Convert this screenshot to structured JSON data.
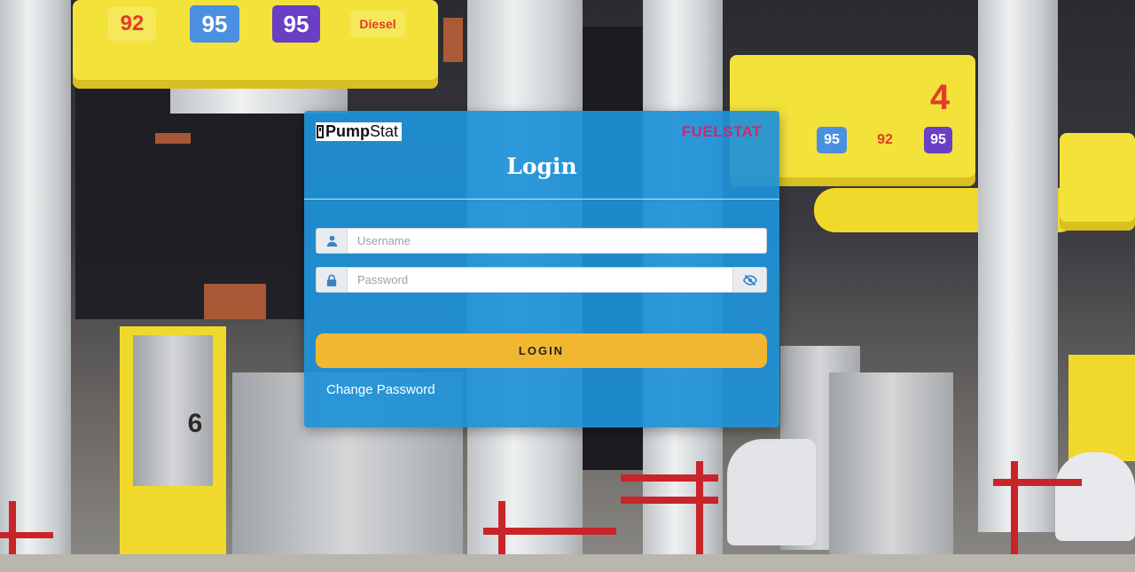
{
  "background": {
    "price_signs_left": [
      "92",
      "95",
      "95",
      "Diesel"
    ],
    "price_signs_right": [
      "95",
      "92",
      "95"
    ],
    "pump_number_right": "4",
    "pump_number_left": "6"
  },
  "login_card": {
    "logo": {
      "prefix": "Pump",
      "suffix": "Stat"
    },
    "brand": "FUELSTAT",
    "title": "Login",
    "username": {
      "placeholder": "Username",
      "value": ""
    },
    "password": {
      "placeholder": "Password",
      "value": ""
    },
    "login_button": "LOGIN",
    "change_password_link": "Change Password"
  },
  "colors": {
    "card_bg": "#1e91d7",
    "brand": "#d6246e",
    "button": "#f2b731",
    "canopy_yellow": "#f3e23a"
  },
  "icons": {
    "username": "user-icon",
    "password": "lock-icon",
    "toggle": "eye-slash-icon"
  }
}
